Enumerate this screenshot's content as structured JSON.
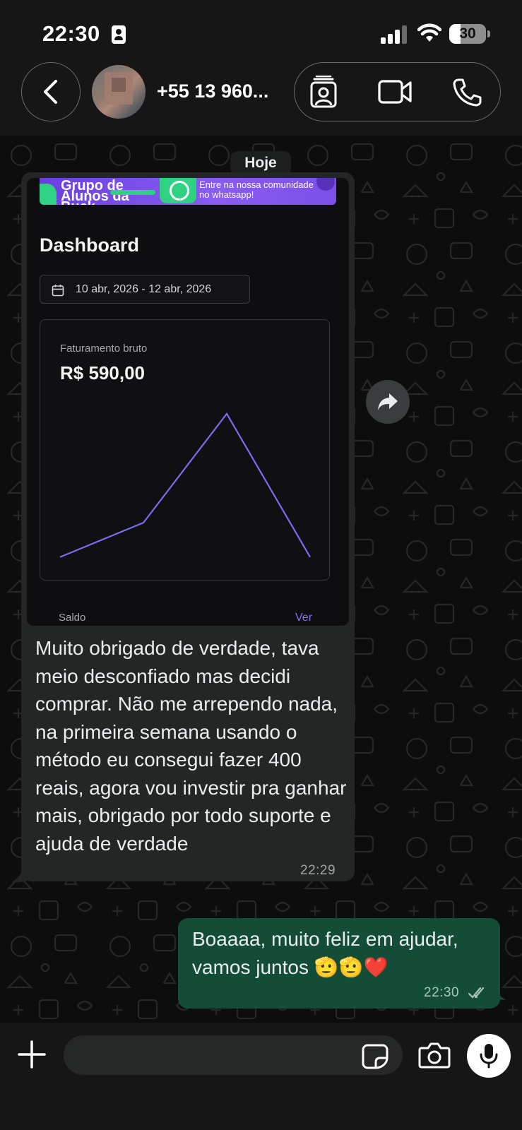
{
  "status_bar": {
    "time": "22:30",
    "battery_level": "30",
    "battery_fraction": 0.3,
    "signal_bars_active": 3,
    "icons": [
      "id-card-icon",
      "signal-icon",
      "wifi-icon",
      "battery-icon"
    ]
  },
  "header": {
    "contact_name": "+55 13 960...",
    "buttons": [
      "back-icon",
      "contact-card-icon",
      "video-call-icon",
      "voice-call-icon"
    ]
  },
  "chat": {
    "date_chip": "Hoje",
    "incoming": {
      "image": {
        "banner": {
          "title": "Grupo de Alunos da Buck",
          "text_line1": "Entre na nossa comunidade",
          "text_line2": "no whatsapp!"
        },
        "dashboard_title": "Dashboard",
        "date_range": "10 abr, 2026 - 12 abr, 2026",
        "card_label": "Faturamento bruto",
        "card_value": "R$ 590,00",
        "chart_data": {
          "type": "line",
          "title": "",
          "xlabel": "",
          "ylabel": "",
          "x": [
            0,
            1,
            2,
            3
          ],
          "values": [
            25,
            110,
            380,
            25
          ],
          "ylim": [
            0,
            420
          ],
          "line_color": "#7b6cf0",
          "grid": false
        },
        "footer_label": "Saldo",
        "footer_link": "Ver"
      },
      "text": "Muito obrigado de verdade, tava meio desconfiado mas decidi comprar. Não me arrependo nada, na primeira semana usando o método eu consegui fazer 400 reais, agora vou investir pra ganhar mais, obrigado por todo suporte e ajuda de verdade",
      "time": "22:29"
    },
    "outgoing": {
      "text": "Boaaaa, muito feliz em ajudar, vamos juntos 🫡🫡❤️",
      "time": "22:30",
      "status": "read"
    }
  },
  "input_bar": {
    "placeholder": "",
    "buttons": [
      "plus-icon",
      "sticker-icon",
      "camera-icon",
      "microphone-icon"
    ]
  },
  "colors": {
    "outgoing_bubble": "#144d37",
    "incoming_bubble": "#242626",
    "accent_purple": "#8a6cf6"
  }
}
